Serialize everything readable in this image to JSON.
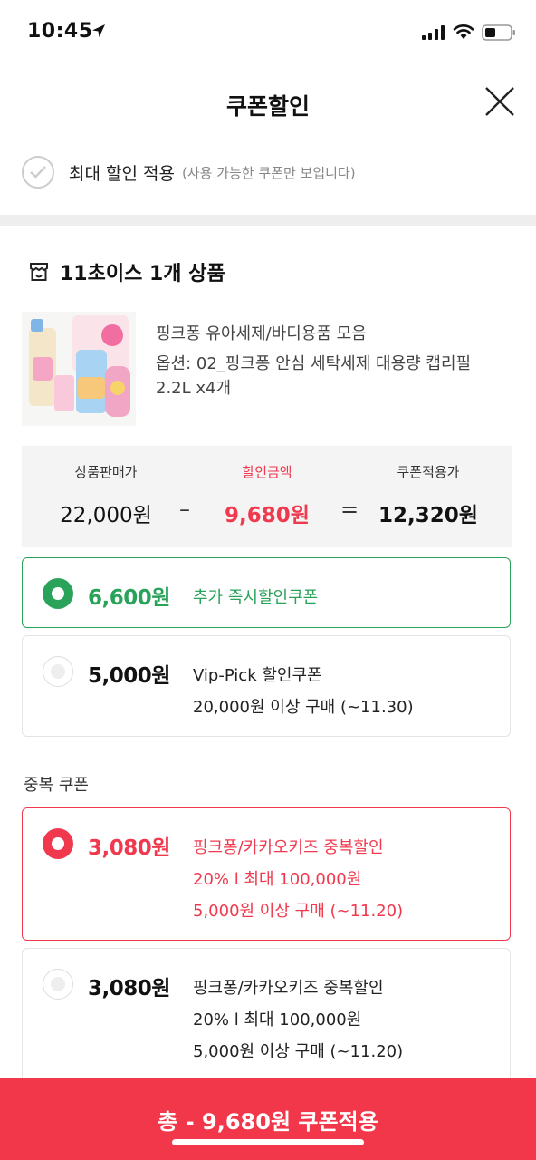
{
  "status": {
    "time": "10:45"
  },
  "header": {
    "title": "쿠폰할인"
  },
  "max_discount": {
    "label": "최대 할인 적용",
    "sub": "(사용 가능한 쿠폰만 보입니다)"
  },
  "section": {
    "title": "11초이스 1개 상품"
  },
  "product": {
    "name": "핑크퐁 유아세제/바디용품 모음",
    "option_line1": "옵션: 02_핑크퐁 안심 세탁세제 대용량 캡리필",
    "option_line2": "2.2L x4개"
  },
  "price": {
    "sale_label": "상품판매가",
    "sale_value": "22,000원",
    "discount_label": "할인금액",
    "discount_value": "9,680원",
    "final_label": "쿠폰적용가",
    "final_value": "12,320원",
    "minus": "–",
    "equals": "="
  },
  "coupons": [
    {
      "amount": "6,600원",
      "line1": "추가 즉시할인쿠폰",
      "selected": true
    },
    {
      "amount": "5,000원",
      "line1": "Vip-Pick 할인쿠폰",
      "line2": "20,000원 이상 구매 (~11.30)",
      "selected": false
    }
  ],
  "dup_label": "중복 쿠폰",
  "dup_coupons": [
    {
      "amount": "3,080원",
      "line1": "핑크퐁/카카오키즈 중복할인",
      "line2": "20% l 최대 100,000원",
      "line3": "5,000원 이상 구매 (~11.20)",
      "selected": true
    },
    {
      "amount": "3,080원",
      "line1": "핑크퐁/카카오키즈 중복할인",
      "line2": "20% l 최대 100,000원",
      "line3": "5,000원 이상 구매 (~11.20)",
      "selected": false
    }
  ],
  "bottom": {
    "label": "총 - 9,680원 쿠폰적용"
  },
  "colors": {
    "green": "#2aa35a",
    "red": "#f0394e",
    "bar": "#f2374a"
  }
}
